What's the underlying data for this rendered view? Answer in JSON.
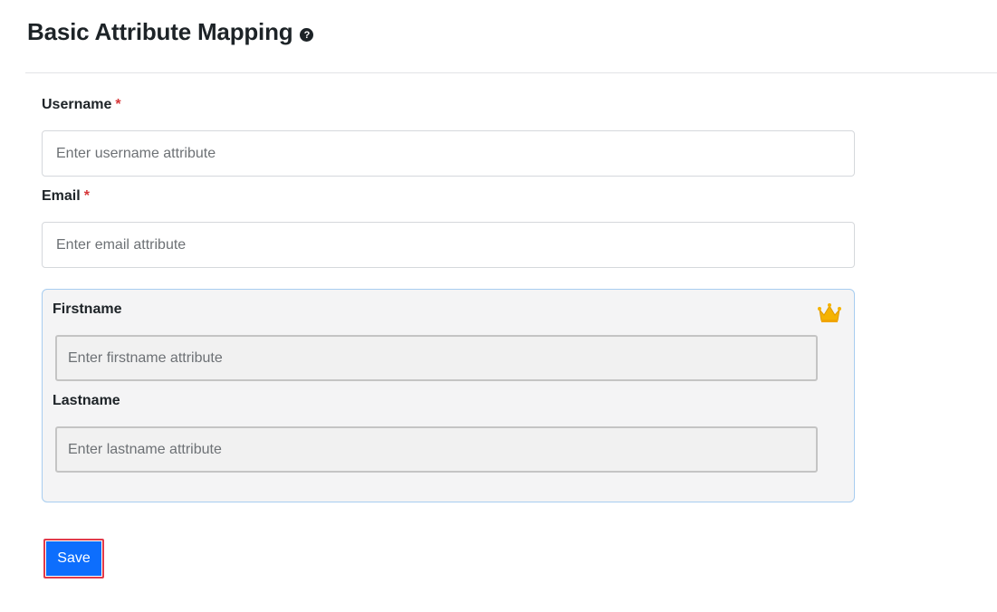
{
  "header": {
    "title": "Basic Attribute Mapping",
    "help_icon": "question-circle-icon",
    "help_glyph": "?"
  },
  "form": {
    "username": {
      "label": "Username",
      "required_marker": "*",
      "placeholder": "Enter username attribute",
      "value": ""
    },
    "email": {
      "label": "Email",
      "required_marker": "*",
      "placeholder": "Enter email attribute",
      "value": ""
    },
    "premium": {
      "badge_icon": "crown-icon",
      "firstname": {
        "label": "Firstname",
        "placeholder": "Enter firstname attribute",
        "value": ""
      },
      "lastname": {
        "label": "Lastname",
        "placeholder": "Enter lastname attribute",
        "value": ""
      }
    },
    "save_label": "Save"
  },
  "colors": {
    "primary": "#0d6efd",
    "required": "#d63638",
    "save_outline": "#e23a4a",
    "premium_border": "#a8cdf0",
    "crown": "#f5b301"
  }
}
